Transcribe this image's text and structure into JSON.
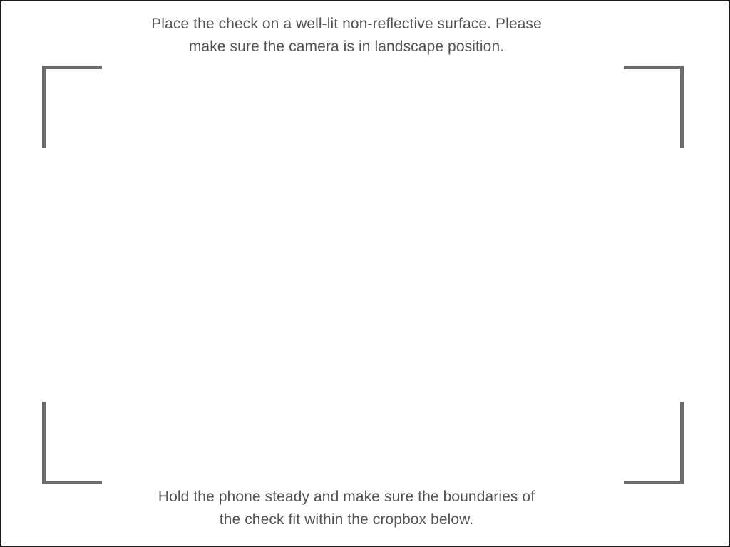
{
  "instructions": {
    "top": {
      "line1": "Place the check on a well-lit non-reflective surface. Please",
      "line2": "make sure the camera is in landscape position."
    },
    "bottom": {
      "line1": "Hold the phone steady and make sure the boundaries of",
      "line2": "the check fit within the cropbox below."
    }
  },
  "colors": {
    "background": "#ffffff",
    "text": "#4f5257",
    "cropbox": "#6a6c70",
    "frame_border": "#1a1a1a"
  }
}
